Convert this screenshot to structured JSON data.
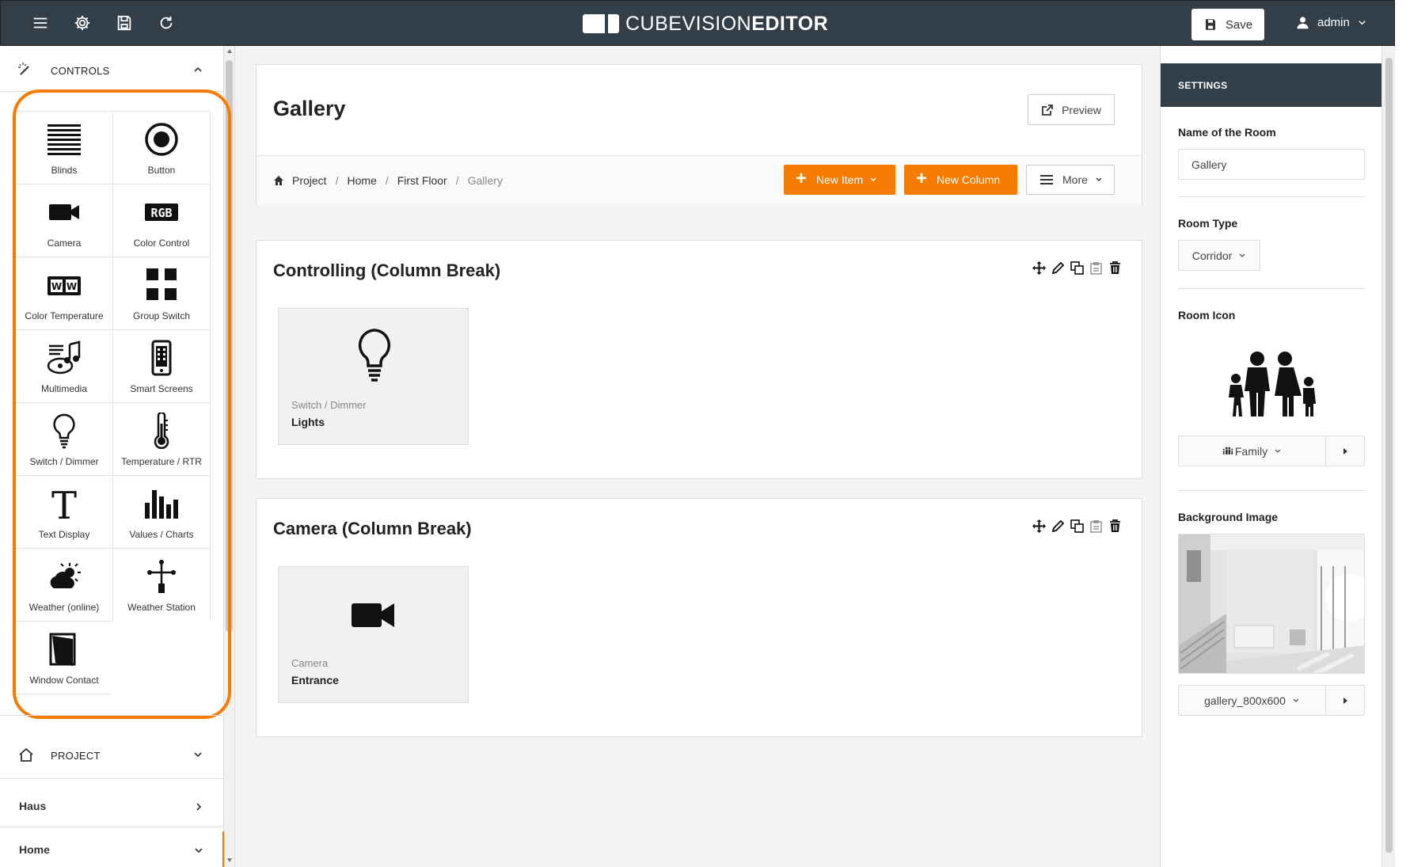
{
  "app": {
    "logo_light": "CUBEVISION",
    "logo_bold": "EDITOR",
    "save_label": "Save",
    "user_label": "admin"
  },
  "sidebar": {
    "controls_title": "CONTROLS",
    "controls": [
      {
        "label": "Blinds",
        "icon": "blinds-icon"
      },
      {
        "label": "Button",
        "icon": "button-icon"
      },
      {
        "label": "Camera",
        "icon": "camera-icon"
      },
      {
        "label": "Color Control",
        "icon": "rgb-icon"
      },
      {
        "label": "Color Temperature",
        "icon": "color-temperature-icon"
      },
      {
        "label": "Group Switch",
        "icon": "group-switch-icon"
      },
      {
        "label": "Multimedia",
        "icon": "multimedia-icon"
      },
      {
        "label": "Smart Screens",
        "icon": "smart-screen-icon"
      },
      {
        "label": "Switch / Dimmer",
        "icon": "lightbulb-icon"
      },
      {
        "label": "Temperature / RTR",
        "icon": "thermometer-icon"
      },
      {
        "label": "Text Display",
        "icon": "text-icon"
      },
      {
        "label": "Values / Charts",
        "icon": "bar-chart-icon"
      },
      {
        "label": "Weather (online)",
        "icon": "weather-icon"
      },
      {
        "label": "Weather Station",
        "icon": "weather-station-icon"
      },
      {
        "label": "Window Contact",
        "icon": "window-contact-icon"
      }
    ],
    "project_title": "PROJECT",
    "nav_items": [
      {
        "label": "Haus"
      },
      {
        "label": "Home"
      }
    ]
  },
  "page": {
    "title": "Gallery",
    "preview_label": "Preview",
    "breadcrumb": [
      "Project",
      "Home",
      "First Floor",
      "Gallery"
    ],
    "new_item_label": "New Item",
    "new_column_label": "New Column",
    "more_label": "More"
  },
  "sections": [
    {
      "title": "Controlling (Column Break)",
      "item": {
        "type": "Switch / Dimmer",
        "name": "Lights",
        "icon": "lightbulb-icon"
      }
    },
    {
      "title": "Camera (Column Break)",
      "item": {
        "type": "Camera",
        "name": "Entrance",
        "icon": "camera-icon"
      }
    }
  ],
  "settings": {
    "header": "SETTINGS",
    "name_label": "Name of the Room",
    "name_value": "Gallery",
    "type_label": "Room Type",
    "type_value": "Corridor",
    "icon_label": "Room Icon",
    "icon_value": "Family",
    "bg_label": "Background Image",
    "bg_value": "gallery_800x600"
  },
  "colors": {
    "topbar": "#333f48",
    "accent": "#f57c00"
  }
}
